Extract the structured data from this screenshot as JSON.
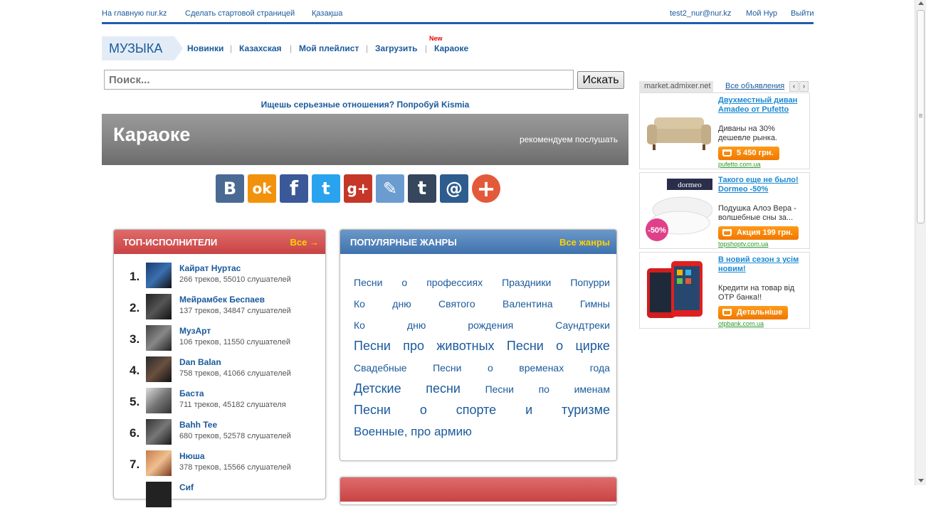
{
  "topbar": {
    "home_link": "На главную nur.kz",
    "start_page_link": "Сделать стартовой страницей",
    "lang_link": "Қазақша",
    "user_email": "test2_nur@nur.kz",
    "my_nur": "Мой Нур",
    "logout": "Выйти"
  },
  "logo": "МУЗЫКА",
  "nav": {
    "items": [
      "Новинки",
      "Казахская",
      "Мой плейлист",
      "Загрузить",
      "Караоке"
    ],
    "separator": "|",
    "new_badge": "New"
  },
  "search": {
    "placeholder": "Поиск...",
    "button": "Искать"
  },
  "promo": "Ищешь серьезные отношения? Попробуй Kismia",
  "banner": {
    "title": "Караоке",
    "right_text": "рекомендуем послушать"
  },
  "share_icons": [
    {
      "name": "vk-icon",
      "glyph": "В",
      "color": "#4a6a94"
    },
    {
      "name": "odnoklassniki-icon",
      "glyph": "ok",
      "color": "#f2920c"
    },
    {
      "name": "facebook-icon",
      "glyph": "f",
      "color": "#3b5998"
    },
    {
      "name": "twitter-icon",
      "glyph": "t",
      "color": "#2aa3ef"
    },
    {
      "name": "googleplus-icon",
      "glyph": "g+",
      "color": "#c53727"
    },
    {
      "name": "livejournal-icon",
      "glyph": "✎",
      "color": "#6a9cd0"
    },
    {
      "name": "tumblr-icon",
      "glyph": "t",
      "color": "#36465d"
    },
    {
      "name": "mailru-icon",
      "glyph": "@",
      "color": "#2d5c8f"
    },
    {
      "name": "more-share-icon",
      "glyph": "+",
      "color": "#e35a3b"
    }
  ],
  "top_artists": {
    "title": "ТОП-ИСПОЛНИТЕЛИ",
    "all_link": "Все →",
    "items": [
      {
        "rank": "1.",
        "name": "Кайрат Нуртас",
        "meta": "266 треков, 55010 слушателей"
      },
      {
        "rank": "2.",
        "name": "Мейрамбек Беспаев",
        "meta": "137 треков, 34847 слушателей"
      },
      {
        "rank": "3.",
        "name": "МузАрт",
        "meta": "106 треков, 11550 слушателей"
      },
      {
        "rank": "4.",
        "name": "Dan Balan",
        "meta": "758 треков, 41066 слушателей"
      },
      {
        "rank": "5.",
        "name": "Баста",
        "meta": "711 треков, 45182 слушателя"
      },
      {
        "rank": "6.",
        "name": "Bahh Tee",
        "meta": "680 треков, 52578 слушателей"
      },
      {
        "rank": "7.",
        "name": "Нюша",
        "meta": "378 треков, 15566 слушателей"
      },
      {
        "rank": "",
        "name": "Сиf",
        "meta": ""
      }
    ]
  },
  "genres": {
    "title": "ПОПУЛЯРНЫЕ ЖАНРЫ",
    "all_link": "Все жанры",
    "lines": [
      {
        "size": 14,
        "words": [
          "Песни",
          "о",
          "профессиях",
          "Праздники",
          "Попурри"
        ]
      },
      {
        "size": 14,
        "words": [
          "Ко",
          "дню",
          "Святого",
          "Валентина",
          "Гимны"
        ]
      },
      {
        "size": 14,
        "words": [
          "Ко",
          "дню",
          "рождения",
          "Саундтреки"
        ]
      },
      {
        "size": 18,
        "words": [
          "Песни",
          "про",
          "животных",
          "Песни",
          "о",
          "цирке"
        ]
      },
      {
        "size": 14,
        "words": [
          "Свадебные",
          "Песни",
          "о",
          "временах",
          "года"
        ]
      },
      {
        "size": 18,
        "words": [
          "Детские",
          "песни",
          "Песни",
          "по",
          "именам"
        ]
      },
      {
        "size": 18,
        "words": [
          "Песни",
          "о",
          "спорте",
          "и",
          "туризме"
        ]
      },
      {
        "size": 17,
        "words": [
          "Военные, про армию"
        ]
      }
    ]
  },
  "ads": {
    "tab_active": "market.admixer.net",
    "tab_link": "Все объявления",
    "items": [
      {
        "title": "Двухместный диван Amadeo от Pufetto",
        "desc": "Диваны на 30% дешевле рынка.",
        "price": "5 450 грн.",
        "domain": "pufetto.com.ua"
      },
      {
        "title": "Такого еще не было! Dormeo -50%",
        "desc": "Подушка Алоэ Вера - волшебные сны за...",
        "price": "Акция 199 грн.",
        "domain": "topshoptv.com.ua",
        "brand": "dormeo",
        "sale": "-50%"
      },
      {
        "title": "В новий сезон з усім новим!",
        "desc": "Кредити на товар від ОТР банка!!",
        "price": "Детальніше",
        "domain": "otpbank.com.ua"
      }
    ]
  }
}
